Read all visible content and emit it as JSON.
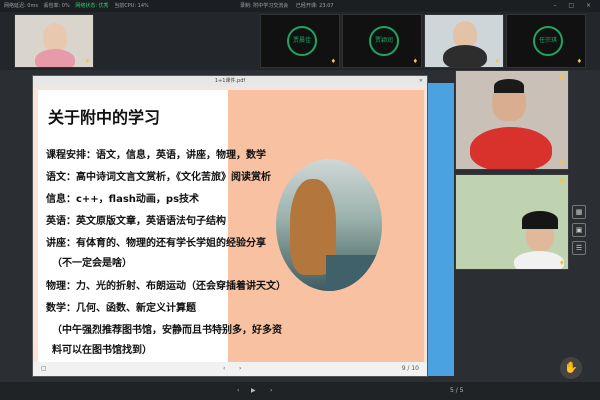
{
  "topbar": {
    "left_stats": [
      "网络延迟: 0ms",
      "丢包率: 0%",
      "网络状态: 优秀",
      "当前CPU: 14%"
    ],
    "center_title": "录制: 附中学习交流会",
    "timer": "已经开课: 23:07",
    "win_controls": "– □ ×"
  },
  "participants": [
    {
      "name": "",
      "avatar_text": ""
    },
    {
      "name": "",
      "avatar_text": "贾晨佳"
    },
    {
      "name": "",
      "avatar_text": "贾颖润"
    },
    {
      "name": "刘思雨",
      "avatar_text": ""
    },
    {
      "name": "",
      "avatar_text": "任宗琪"
    }
  ],
  "doc": {
    "title": "1+1课件.pdf",
    "slide_title": "关于附中的学习",
    "lines": [
      "课程安排：语文，信息，英语，讲座，物理，数学",
      "语文：高中诗词文言文赏析，《文化苦旅》阅读赏析",
      "信息：c++，flash动画，ps技术",
      "英语：英文原版文章，英语语法句子结构",
      "讲座：有体育的、物理的还有学长学姐的经验分享",
      "（不一定会是啥）",
      "物理：力、光的折射、布朗运动（还会穿插着讲天文）",
      "数学：几何、函数、新定义计算题",
      "（中午强烈推荐图书馆，安静而且书特别多，好多资",
      "料可以在图书馆找到）"
    ],
    "page_indicator": "9 / 10",
    "bottom_page": "5 / 5"
  },
  "colors": {
    "slide_bg": "#f7c1a2",
    "accent_blue": "#4aa3e0",
    "mic": "#f5c542"
  }
}
